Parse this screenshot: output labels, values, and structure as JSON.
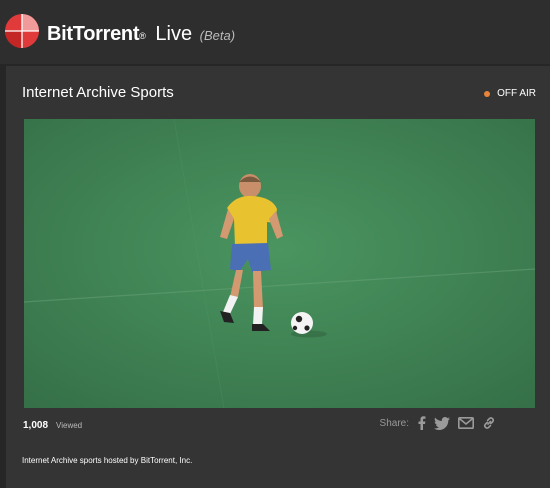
{
  "app": {
    "brand_name": "BitTorrent",
    "brand_reg": "®",
    "brand_product": "Live",
    "brand_beta": "(Beta)",
    "logo_colors": [
      "#e03a3a",
      "#f6a3a3"
    ]
  },
  "channel": {
    "title": "Internet Archive Sports",
    "status_label": "OFF AIR",
    "status_color": "#e8843a"
  },
  "video": {
    "scene": "soccer-player-dribbling-ball",
    "pitch_color": "#3f8a55"
  },
  "stats": {
    "view_count": "1,008",
    "view_label": "Viewed"
  },
  "share": {
    "label": "Share:",
    "icons": [
      "facebook-icon",
      "twitter-icon",
      "email-icon",
      "link-icon"
    ]
  },
  "description": "Internet Archive sports hosted by BitTorrent, Inc."
}
